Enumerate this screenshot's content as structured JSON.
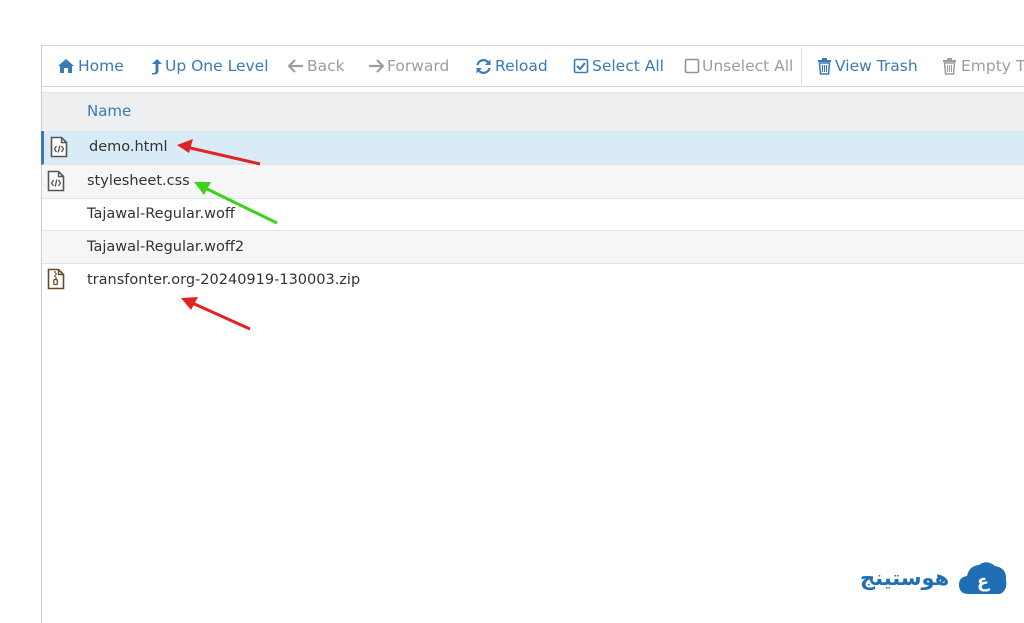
{
  "toolbar": {
    "home": "Home",
    "up_one_level": "Up One Level",
    "back": "Back",
    "forward": "Forward",
    "reload": "Reload",
    "select_all": "Select All",
    "unselect_all": "Unselect All",
    "view_trash": "View Trash",
    "empty_trash": "Empty Tr"
  },
  "table": {
    "column_name": "Name",
    "rows": [
      {
        "name": "demo.html",
        "icon": "code-file-icon",
        "selected": true
      },
      {
        "name": "stylesheet.css",
        "icon": "code-file-icon",
        "selected": false
      },
      {
        "name": "Tajawal-Regular.woff",
        "icon": "",
        "selected": false
      },
      {
        "name": "Tajawal-Regular.woff2",
        "icon": "",
        "selected": false
      },
      {
        "name": "transfonter.org-20240919-130003.zip",
        "icon": "zip-file-icon",
        "selected": false
      }
    ]
  },
  "logo": {
    "text": "هوستينج",
    "letter": "ع"
  },
  "colors": {
    "accent": "#3a7ab5",
    "selected_row": "#d9ebf7",
    "arrow_red": "#e02424",
    "arrow_green": "#3cd11c",
    "logo": "#1e6fb4"
  }
}
